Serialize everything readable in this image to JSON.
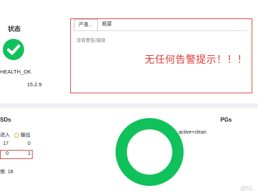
{
  "status": {
    "title": "状态",
    "health": "HEALTH_OK",
    "version": "15.2.9",
    "icon": "check-circle-icon",
    "color": "#11c15b"
  },
  "alerts": {
    "tabs": [
      {
        "label": "严重...",
        "active": true
      },
      {
        "label": "概要",
        "active": false
      }
    ],
    "empty_text": "没有警告/错误",
    "annotation": "无任何告警提示！！！",
    "highlight_color": "#d9534f",
    "annotation_color": "#e33a35"
  },
  "osds": {
    "title": "SDs",
    "legend_in": "进入",
    "legend_out": "输出",
    "rows": [
      {
        "in": "17",
        "out": "0"
      },
      {
        "in": "0",
        "out": "1"
      }
    ],
    "total_label": "係: 18"
  },
  "pgs": {
    "title": "PGs",
    "legend": "active+clean",
    "color": "#11c15b"
  },
  "chart_data": {
    "type": "pie",
    "categories": [
      "active+clean"
    ],
    "values": [
      100
    ]
  },
  "watermark": "@51"
}
